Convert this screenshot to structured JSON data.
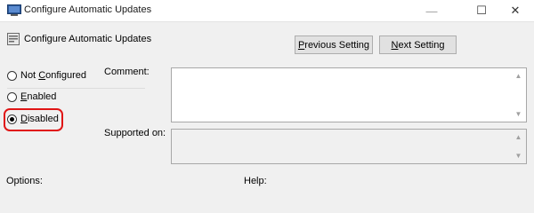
{
  "window": {
    "title": "Configure Automatic Updates",
    "controls": {
      "minimize": "—",
      "maximize": "☐",
      "close": "✕"
    }
  },
  "header": {
    "policy_title": "Configure Automatic Updates",
    "icon": "policy-settings-icon"
  },
  "navigation": {
    "previous_label_accel": "P",
    "previous_label_rest": "revious Setting",
    "next_label_accel": "N",
    "next_label_rest": "ext Setting"
  },
  "state": {
    "options": [
      {
        "pre": "Not ",
        "accel": "C",
        "post": "onfigured",
        "selected": false
      },
      {
        "pre": "",
        "accel": "E",
        "post": "nabled",
        "selected": false
      },
      {
        "pre": "",
        "accel": "D",
        "post": "isabled",
        "selected": true
      }
    ]
  },
  "fields": {
    "comment_label": "Comment:",
    "comment_value": "",
    "supported_label": "Supported on:",
    "supported_value": ""
  },
  "sections": {
    "options_label": "Options:",
    "help_label": "Help:"
  },
  "colors": {
    "highlight": "#e01515",
    "title_icon_blue": "#2b5797"
  }
}
